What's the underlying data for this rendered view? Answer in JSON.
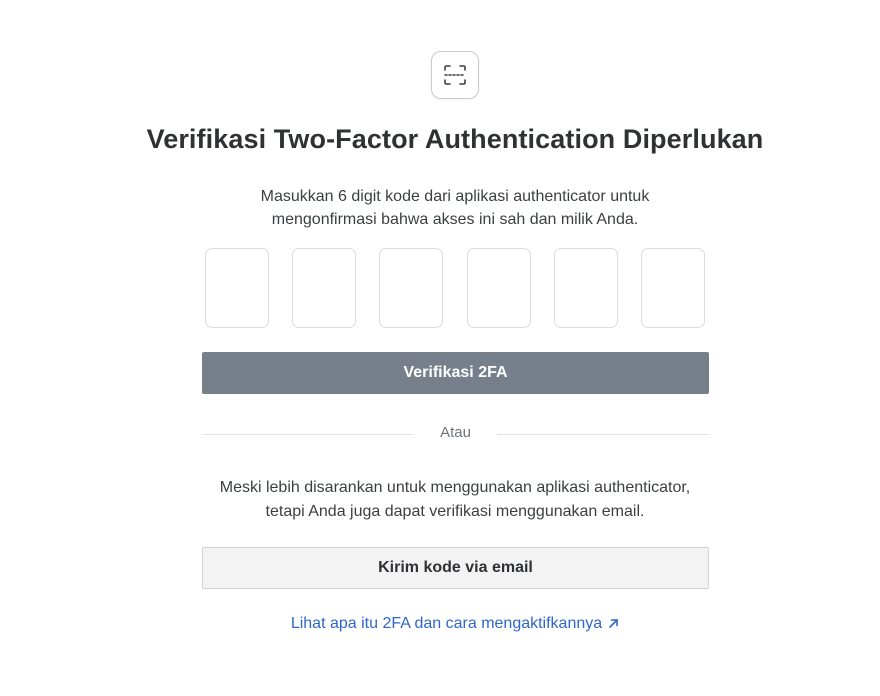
{
  "header": {
    "icon": "scan-icon",
    "title": "Verifikasi Two-Factor Authentication Diperlukan",
    "subtitle_line1": "Masukkan 6 digit kode dari aplikasi authenticator untuk",
    "subtitle_line2": "mengonfirmasi bahwa akses ini sah dan milik Anda."
  },
  "otp": {
    "digits": [
      "",
      "",
      "",
      "",
      "",
      ""
    ]
  },
  "verify_button": {
    "label": "Verifikasi 2FA"
  },
  "divider": {
    "label": "Atau"
  },
  "alternative": {
    "text_line1": "Meski lebih disarankan untuk menggunakan aplikasi authenticator,",
    "text_line2": "tetapi Anda juga dapat verifikasi menggunakan email."
  },
  "email_button": {
    "label": "Kirim kode via email"
  },
  "help_link": {
    "label": "Lihat apa itu 2FA dan cara mengaktifkannya",
    "icon": "external-arrow-icon"
  },
  "colors": {
    "primary_button": "#77808a",
    "link": "#2f67c9",
    "secondary_button": "#f3f3f4"
  }
}
